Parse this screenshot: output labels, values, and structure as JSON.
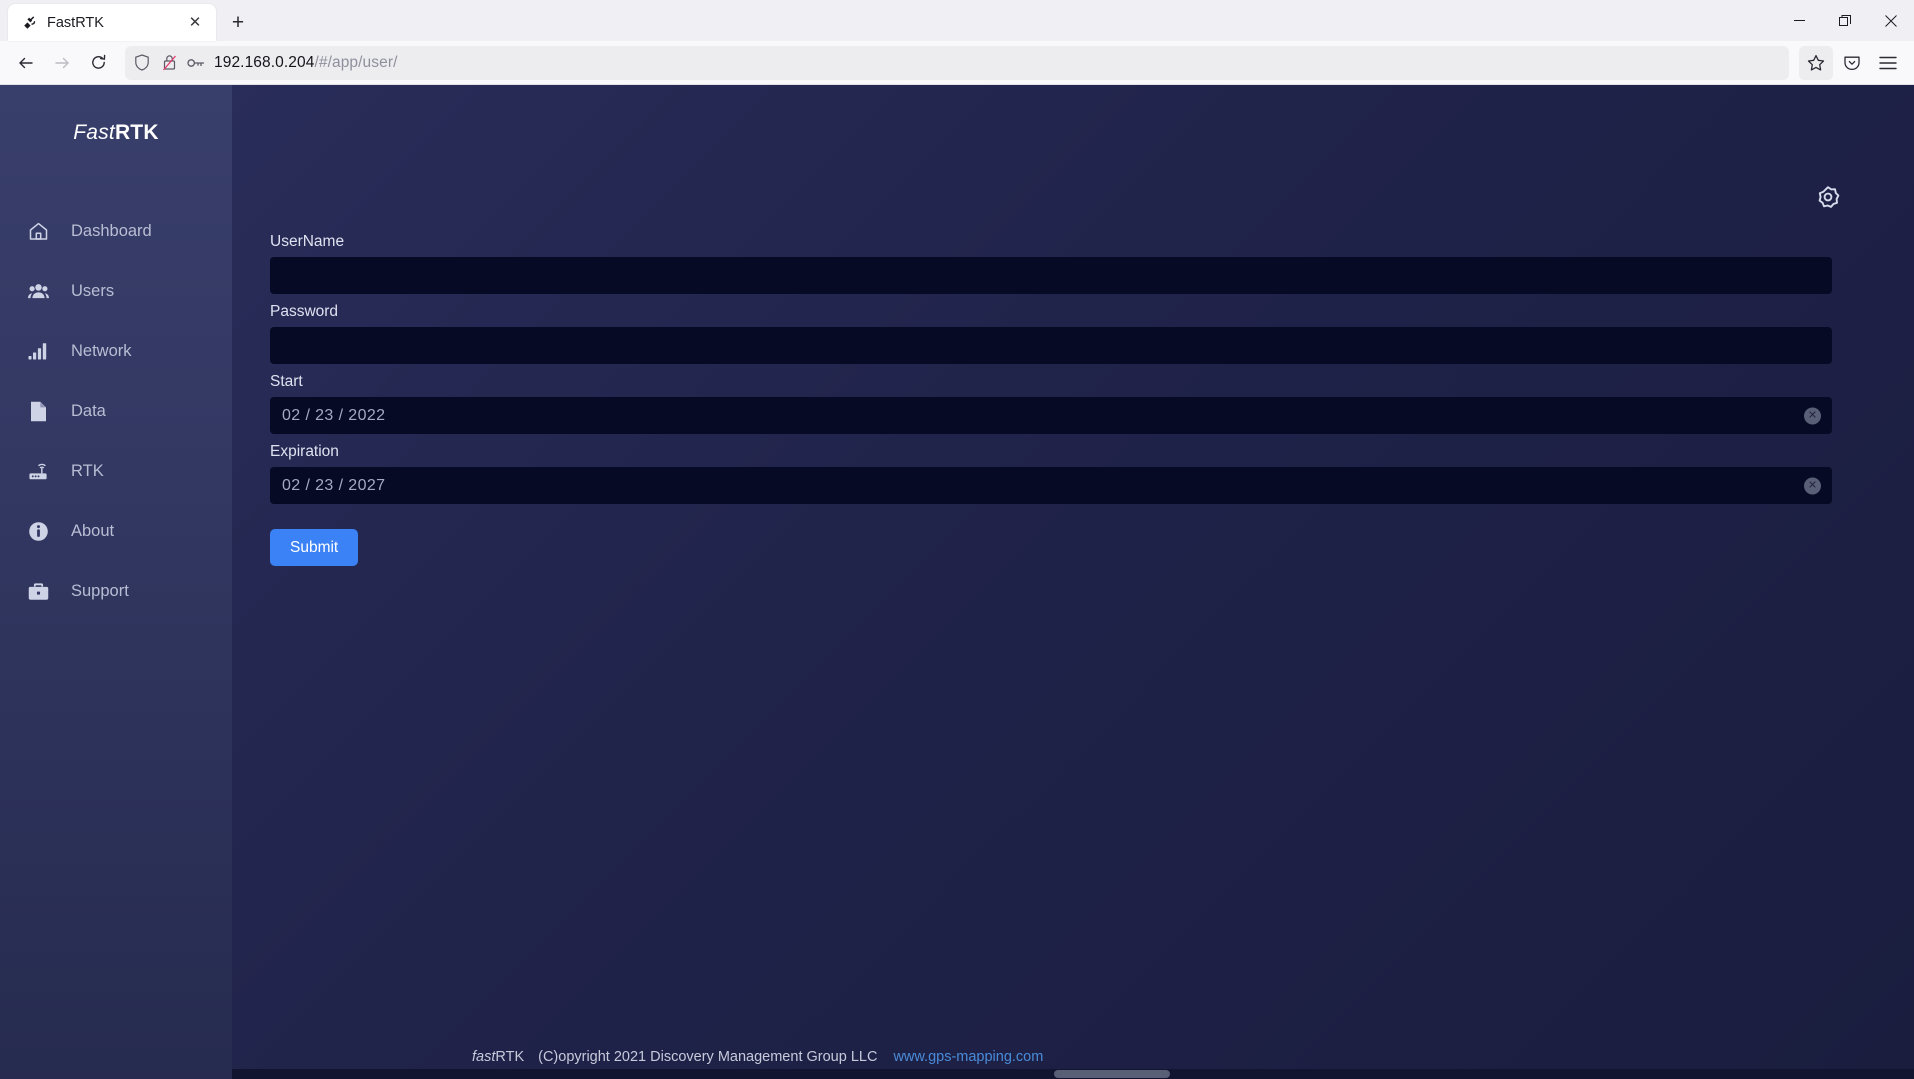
{
  "browser": {
    "tab": {
      "title": "FastRTK",
      "favicon_icon": "satellite-icon",
      "close_icon": "✕"
    },
    "new_tab_icon": "+",
    "window_controls": {
      "minimize": "—",
      "restore": "restore-icon",
      "close": "✕"
    },
    "nav": {
      "back_icon": "←",
      "forward_icon": "→",
      "reload_icon": "reload-icon"
    },
    "url": {
      "host": "192.168.0.204",
      "path": "/#/app/user/",
      "shield_icon": "shield-icon",
      "permission_icon": "broken-lock-icon",
      "key_icon": "key-icon"
    },
    "toolbar_right": {
      "bookmark_icon": "star-icon",
      "pocket_icon": "pocket-icon",
      "menu_icon": "hamburger-menu-icon"
    }
  },
  "app": {
    "brand": {
      "part1": "Fast",
      "part2": "RTK"
    },
    "settings_icon": "gear-icon",
    "sidebar": {
      "items": [
        {
          "label": "Dashboard",
          "icon": "home-icon"
        },
        {
          "label": "Users",
          "icon": "users-icon"
        },
        {
          "label": "Network",
          "icon": "signal-bars-icon"
        },
        {
          "label": "Data",
          "icon": "file-icon"
        },
        {
          "label": "RTK",
          "icon": "router-icon"
        },
        {
          "label": "About",
          "icon": "info-circle-icon"
        },
        {
          "label": "Support",
          "icon": "briefcase-icon"
        }
      ]
    },
    "form": {
      "username": {
        "label": "UserName",
        "value": "",
        "placeholder": ""
      },
      "password": {
        "label": "Password",
        "value": "",
        "placeholder": ""
      },
      "start": {
        "label": "Start",
        "value": "02 / 23 / 2022",
        "clear_icon": "clear-circle-icon"
      },
      "expiration": {
        "label": "Expiration",
        "value": "02 / 23 / 2027",
        "clear_icon": "clear-circle-icon"
      },
      "submit_label": "Submit"
    },
    "footer": {
      "brand_italic": "fast",
      "brand_rest": "RTK",
      "copyright": "(C)opyright 2021 Discovery Management Group LLC",
      "link": "www.gps-mapping.com"
    },
    "colors": {
      "accent_blue": "#3b82f6",
      "link_blue": "#4a8bd8",
      "sidebar_bg": "#343a63",
      "content_bg": "#20234a",
      "input_bg": "#060a24"
    }
  }
}
